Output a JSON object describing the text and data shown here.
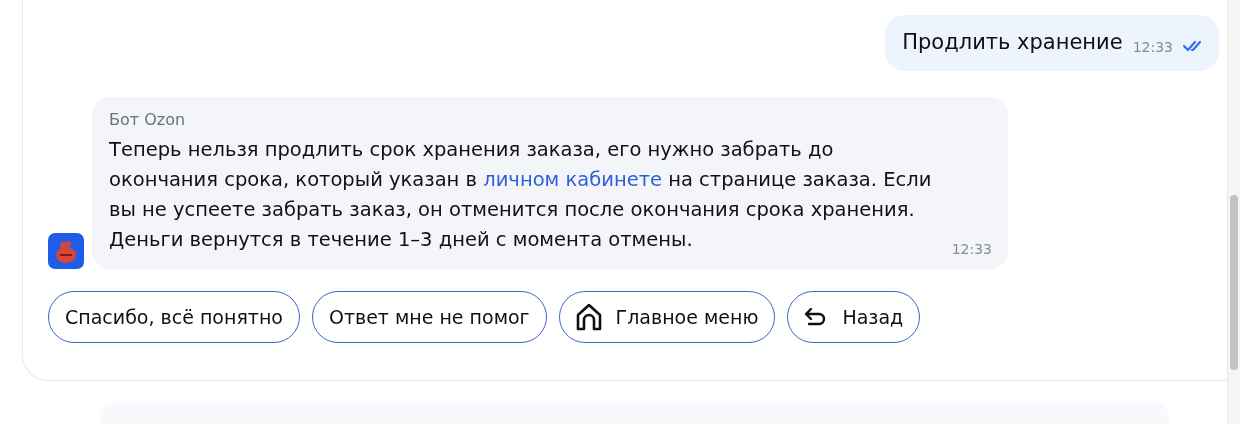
{
  "user_message": {
    "text": "Продлить хранение",
    "time": "12:33",
    "read": true
  },
  "bot_message": {
    "sender": "Бот Ozon",
    "text_before": "Теперь нельзя продлить срок хранения заказа, его нужно забрать до окончания срока, который указан в ",
    "link": "личном кабинете",
    "text_after": " на странице заказа. Если вы не успеете забрать заказ, он отменится после окончания срока хранения. Деньги вернутся в течение 1–3 дней с момента отмены.",
    "time": "12:33"
  },
  "quick_replies": [
    {
      "label": "Спасибо, всё понятно",
      "kind": "plain"
    },
    {
      "label": "Ответ мне не помог",
      "kind": "plain"
    },
    {
      "label": "Главное меню",
      "kind": "home"
    },
    {
      "label": "Назад",
      "kind": "back"
    }
  ]
}
